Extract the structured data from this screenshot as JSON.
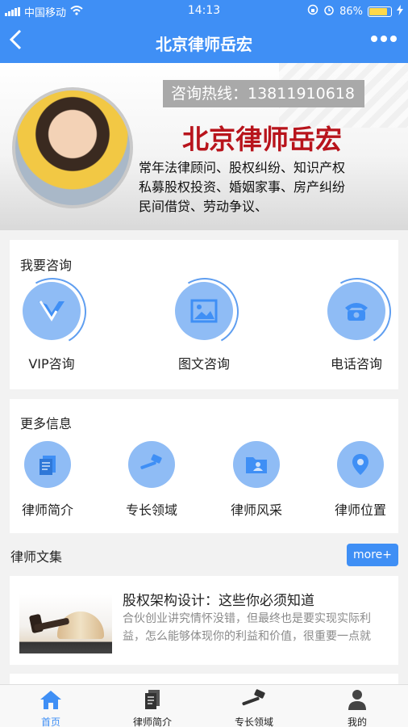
{
  "status": {
    "carrier": "中国移动",
    "time": "14:13",
    "battery": "86%",
    "battery_level": 0.86
  },
  "nav": {
    "title": "北京律师岳宏",
    "back_icon": "chevron-left-icon",
    "more_icon": "more-dots-icon"
  },
  "banner": {
    "hotline": "咨询热线：13811910618",
    "name": "北京律师岳宏",
    "desc_lines": [
      "常年法律顾问、股权纠纷、知识产权",
      "私募股权投资、婚姻家事、房产纠纷",
      "民间借贷、劳动争议、"
    ]
  },
  "consult": {
    "title": "我要咨询",
    "items": [
      {
        "label": "VIP咨询",
        "icon": "vip-icon"
      },
      {
        "label": "图文咨询",
        "icon": "image-icon"
      },
      {
        "label": "电话咨询",
        "icon": "phone-icon"
      }
    ]
  },
  "info": {
    "title": "更多信息",
    "items": [
      {
        "label": "律师简介",
        "icon": "document-icon"
      },
      {
        "label": "专长领域",
        "icon": "gavel-icon"
      },
      {
        "label": "律师风采",
        "icon": "folder-icon"
      },
      {
        "label": "律师位置",
        "icon": "location-pin-icon"
      }
    ]
  },
  "articles": {
    "title": "律师文集",
    "more": "more+",
    "items": [
      {
        "heading": "股权架构设计：这些你必须知道",
        "body": "合伙创业讲究情怀没错，但最终也是要实现实际利益，怎么能够体现你的利益和价值，很重要一点就"
      }
    ]
  },
  "tabbar": {
    "items": [
      {
        "label": "首页",
        "icon": "home-icon"
      },
      {
        "label": "律师简介",
        "icon": "document-icon"
      },
      {
        "label": "专长领域",
        "icon": "gavel-icon"
      },
      {
        "label": "我的",
        "icon": "user-icon"
      }
    ]
  },
  "colors": {
    "primary": "#3f8ff5",
    "icon_circle": "#8fbcf5",
    "banner_name": "#b8141c"
  }
}
